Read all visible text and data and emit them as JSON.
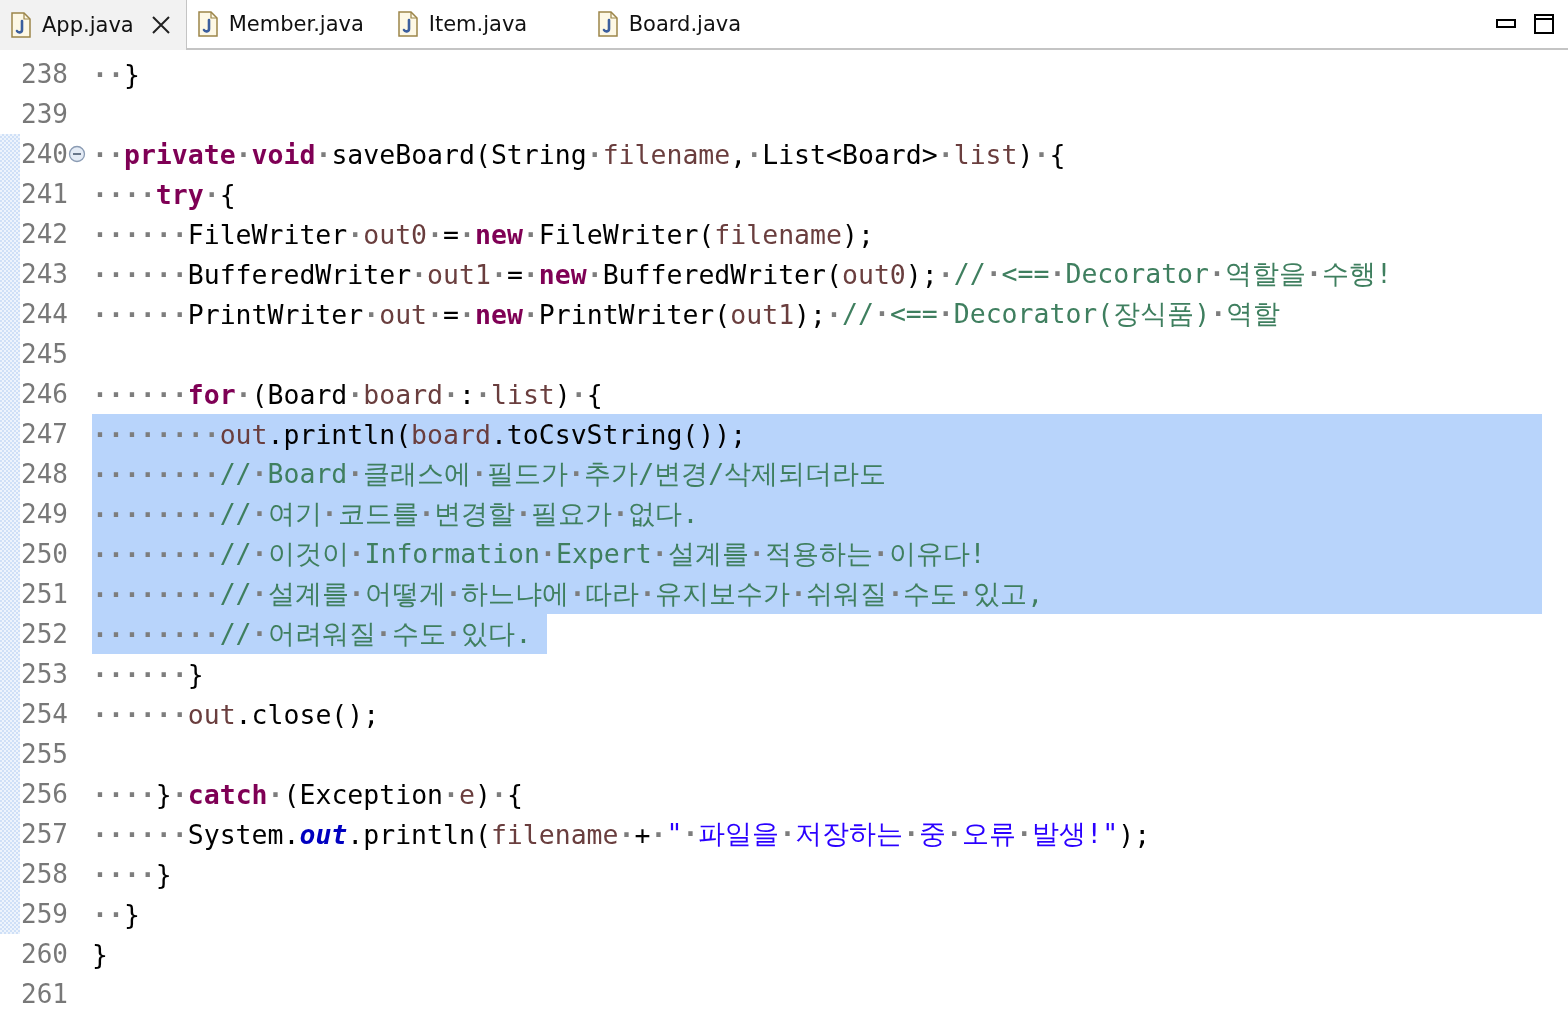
{
  "tabs": [
    {
      "label": "App.java",
      "selected": true
    },
    {
      "label": "Member.java",
      "selected": false
    },
    {
      "label": "Item.java",
      "selected": false
    },
    {
      "label": "Board.java",
      "selected": false
    }
  ],
  "editor": {
    "lines": [
      {
        "number": "238",
        "in_range": false,
        "selected": false,
        "tokens": [
          {
            "kind": "plain",
            "t": "··}"
          }
        ]
      },
      {
        "number": "239",
        "in_range": false,
        "selected": false
      },
      {
        "number": "240",
        "in_range": true,
        "folded": false,
        "selected": false,
        "tokens": [
          {
            "kind": "plain",
            "t": "··"
          },
          {
            "kind": "keyword",
            "t": "private"
          },
          {
            "kind": "plain",
            "t": "·"
          },
          {
            "kind": "keyword",
            "t": "void"
          },
          {
            "kind": "plain",
            "t": "·saveBoard(String·"
          },
          {
            "kind": "variable",
            "t": "filename"
          },
          {
            "kind": "plain",
            "t": ",·List<Board>·"
          },
          {
            "kind": "variable",
            "t": "list"
          },
          {
            "kind": "plain",
            "t": ")·{"
          }
        ]
      },
      {
        "number": "241",
        "in_range": true,
        "selected": false,
        "tokens": [
          {
            "kind": "plain",
            "t": "····"
          },
          {
            "kind": "keyword",
            "t": "try"
          },
          {
            "kind": "plain",
            "t": "·{"
          }
        ]
      },
      {
        "number": "242",
        "in_range": true,
        "selected": false,
        "tokens": [
          {
            "kind": "plain",
            "t": "······FileWriter·"
          },
          {
            "kind": "variable",
            "t": "out0"
          },
          {
            "kind": "plain",
            "t": "·=·"
          },
          {
            "kind": "keyword",
            "t": "new"
          },
          {
            "kind": "plain",
            "t": "·FileWriter("
          },
          {
            "kind": "variable",
            "t": "filename"
          },
          {
            "kind": "plain",
            "t": ");"
          }
        ]
      },
      {
        "number": "243",
        "in_range": true,
        "selected": false,
        "tokens": [
          {
            "kind": "plain",
            "t": "······BufferedWriter·"
          },
          {
            "kind": "variable",
            "t": "out1"
          },
          {
            "kind": "plain",
            "t": "·=·"
          },
          {
            "kind": "keyword",
            "t": "new"
          },
          {
            "kind": "plain",
            "t": "·BufferedWriter("
          },
          {
            "kind": "variable",
            "t": "out0"
          },
          {
            "kind": "plain",
            "t": ");·"
          },
          {
            "kind": "comment",
            "t": "//·<==·Decorator·역할을·수행!"
          }
        ]
      },
      {
        "number": "244",
        "in_range": true,
        "selected": false,
        "tokens": [
          {
            "kind": "plain",
            "t": "······PrintWriter·"
          },
          {
            "kind": "variable",
            "t": "out"
          },
          {
            "kind": "plain",
            "t": "·=·"
          },
          {
            "kind": "keyword",
            "t": "new"
          },
          {
            "kind": "plain",
            "t": "·PrintWriter("
          },
          {
            "kind": "variable",
            "t": "out1"
          },
          {
            "kind": "plain",
            "t": ");·"
          },
          {
            "kind": "comment",
            "t": "//·<==·Decorator(장식품)·역할"
          }
        ]
      },
      {
        "number": "245",
        "in_range": true,
        "selected": false
      },
      {
        "number": "246",
        "in_range": true,
        "selected": false,
        "tokens": [
          {
            "kind": "plain",
            "t": "······"
          },
          {
            "kind": "keyword",
            "t": "for"
          },
          {
            "kind": "plain",
            "t": "·(Board·"
          },
          {
            "kind": "variable",
            "t": "board"
          },
          {
            "kind": "plain",
            "t": "·:·"
          },
          {
            "kind": "variable",
            "t": "list"
          },
          {
            "kind": "plain",
            "t": ")·{"
          }
        ]
      },
      {
        "number": "247",
        "in_range": true,
        "selected": true,
        "tokens": [
          {
            "kind": "plain",
            "t": "········"
          },
          {
            "kind": "variable",
            "t": "out"
          },
          {
            "kind": "plain",
            "t": ".println("
          },
          {
            "kind": "variable",
            "t": "board"
          },
          {
            "kind": "plain",
            "t": ".toCsvString());"
          }
        ]
      },
      {
        "number": "248",
        "in_range": true,
        "selected": true,
        "tokens": [
          {
            "kind": "plain",
            "t": "········"
          },
          {
            "kind": "comment",
            "t": "//·Board·클래스에·필드가·추가/변경/삭제되더라도"
          }
        ]
      },
      {
        "number": "249",
        "in_range": true,
        "selected": true,
        "tokens": [
          {
            "kind": "plain",
            "t": "········"
          },
          {
            "kind": "comment",
            "t": "//·여기·코드를·변경할·필요가·없다."
          }
        ]
      },
      {
        "number": "250",
        "in_range": true,
        "selected": true,
        "tokens": [
          {
            "kind": "plain",
            "t": "········"
          },
          {
            "kind": "comment",
            "t": "//·이것이·Information·Expert·설계를·적용하는·이유다!"
          }
        ]
      },
      {
        "number": "251",
        "in_range": true,
        "selected": true,
        "tokens": [
          {
            "kind": "plain",
            "t": "········"
          },
          {
            "kind": "comment",
            "t": "//·설계를·어떻게·하느냐에·따라·유지보수가·쉬워질·수도·있고,"
          }
        ]
      },
      {
        "number": "252",
        "in_range": true,
        "selected": true,
        "tokens": [
          {
            "kind": "plain",
            "t": "········"
          },
          {
            "kind": "comment",
            "t": "//·어려워질·수도·있다."
          }
        ]
      },
      {
        "number": "253",
        "in_range": true,
        "selected": false,
        "tokens": [
          {
            "kind": "plain",
            "t": "······}"
          }
        ]
      },
      {
        "number": "254",
        "in_range": true,
        "selected": false,
        "tokens": [
          {
            "kind": "plain",
            "t": "······"
          },
          {
            "kind": "variable",
            "t": "out"
          },
          {
            "kind": "plain",
            "t": ".close();"
          }
        ]
      },
      {
        "number": "255",
        "in_range": true,
        "selected": false
      },
      {
        "number": "256",
        "in_range": true,
        "selected": false,
        "tokens": [
          {
            "kind": "plain",
            "t": "····}·"
          },
          {
            "kind": "keyword",
            "t": "catch"
          },
          {
            "kind": "plain",
            "t": "·(Exception·"
          },
          {
            "kind": "variable",
            "t": "e"
          },
          {
            "kind": "plain",
            "t": ")·{"
          }
        ]
      },
      {
        "number": "257",
        "in_range": true,
        "selected": false,
        "tokens": [
          {
            "kind": "plain",
            "t": "······System."
          },
          {
            "kind": "field",
            "t": "out"
          },
          {
            "kind": "plain",
            "t": ".println("
          },
          {
            "kind": "variable",
            "t": "filename"
          },
          {
            "kind": "plain",
            "t": "·+·"
          },
          {
            "kind": "string",
            "t": "\"·파일을·저장하는·중·오류·발생!\""
          },
          {
            "kind": "plain",
            "t": ");"
          }
        ]
      },
      {
        "number": "258",
        "in_range": true,
        "selected": false,
        "tokens": [
          {
            "kind": "plain",
            "t": "····}"
          }
        ]
      },
      {
        "number": "259",
        "in_range": true,
        "selected": false,
        "tokens": [
          {
            "kind": "plain",
            "t": "··}"
          }
        ]
      },
      {
        "number": "260",
        "in_range": false,
        "selected": false,
        "tokens": [
          {
            "kind": "plain",
            "t": "}"
          }
        ]
      },
      {
        "number": "261",
        "in_range": false,
        "selected": false
      }
    ]
  }
}
